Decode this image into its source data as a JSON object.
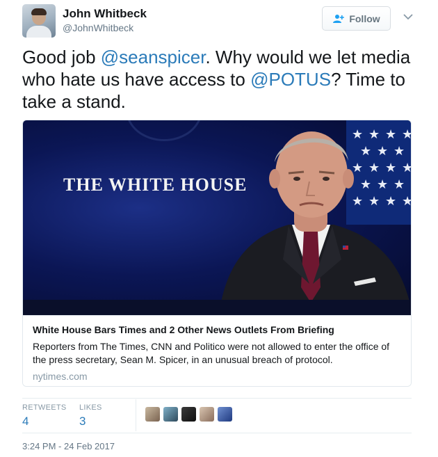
{
  "user": {
    "name": "John Whitbeck",
    "handle": "@JohnWhitbeck",
    "follow_label": "Follow"
  },
  "tweet": {
    "text_1": "Good job ",
    "mention_1": "@seanspicer",
    "text_2": ".  Why would we let media who hate us have access to ",
    "mention_2": "@POTUS",
    "text_3": "? Time to take a stand."
  },
  "card": {
    "image_text": "THE WHITE HOUSE",
    "title": "White House Bars Times and 2 Other News Outlets From Briefing",
    "description": "Reporters from The Times, CNN and Politico were not allowed to enter the office of the press secretary, Sean M. Spicer, in an unusual breach of protocol.",
    "domain": "nytimes.com"
  },
  "stats": {
    "retweets_label": "RETWEETS",
    "retweets_count": "4",
    "likes_label": "LIKES",
    "likes_count": "3"
  },
  "likers": [
    "avatar-1",
    "avatar-2",
    "avatar-3",
    "avatar-4",
    "avatar-5"
  ],
  "timestamp": "3:24 PM - 24 Feb 2017",
  "colors": {
    "link": "#2b7bb9",
    "muted": "#657786",
    "text": "#14171a",
    "border": "#e1e8ed"
  }
}
